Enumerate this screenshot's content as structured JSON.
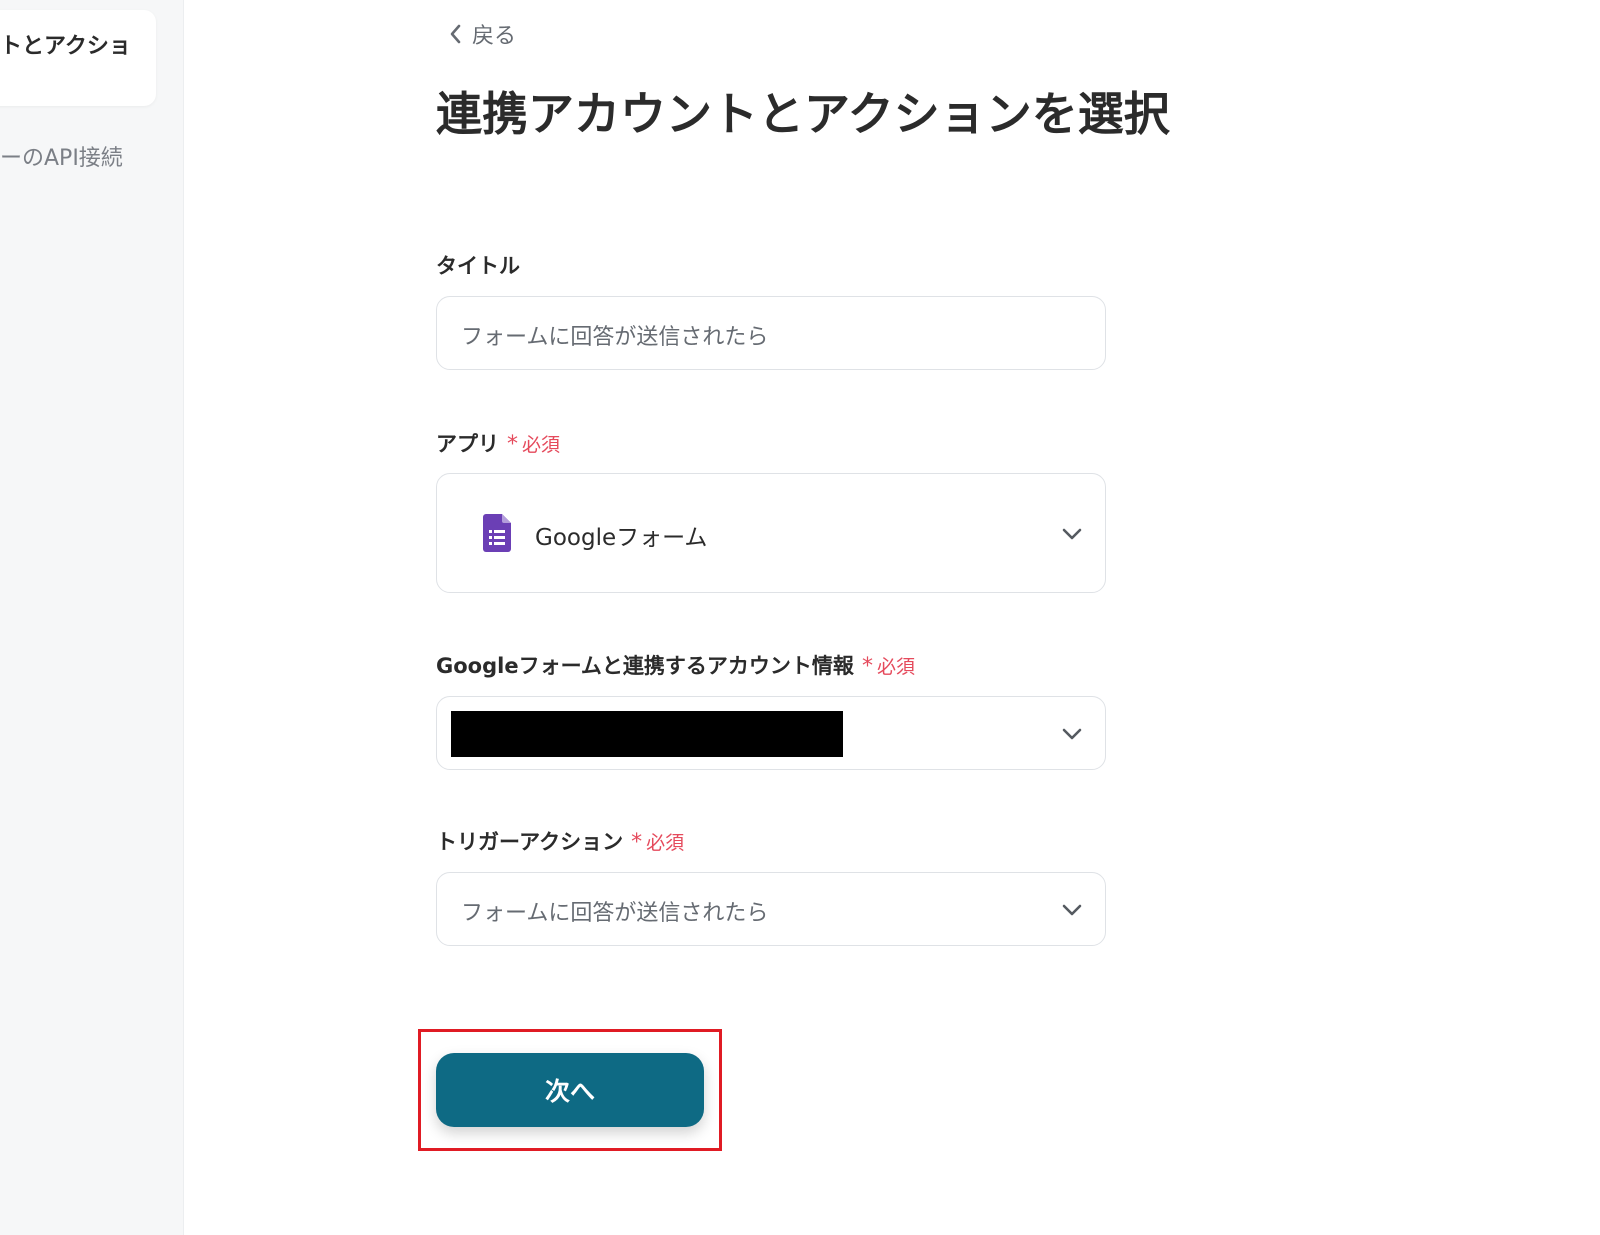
{
  "sidebar": {
    "active_step": "トとアクショ",
    "next_step": "ーのAPI接続"
  },
  "header": {
    "back_label": "戻る",
    "title": "連携アカウントとアクションを選択"
  },
  "form": {
    "required_label": "必須",
    "required_mark": "*",
    "title_field": {
      "label": "タイトル",
      "value": "フォームに回答が送信されたら"
    },
    "app_field": {
      "label": "アプリ",
      "value": "Googleフォーム",
      "icon": "google-forms-icon"
    },
    "account_field": {
      "label": "Googleフォームと連携するアカウント情報",
      "value_redacted": true
    },
    "trigger_field": {
      "label": "トリガーアクション",
      "value": "フォームに回答が送信されたら"
    },
    "next_button": "次へ"
  },
  "colors": {
    "accent": "#0e6a84",
    "required": "#e54a5c",
    "highlight": "#e01b24",
    "forms_purple": "#6b3fb5"
  }
}
